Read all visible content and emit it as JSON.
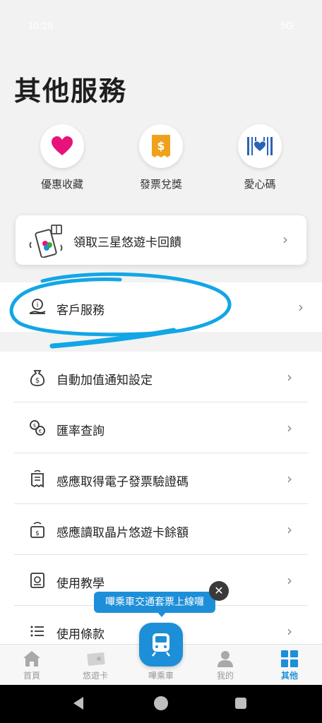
{
  "status_bar": {
    "time": "10:28",
    "network": "5G"
  },
  "page_title": "其他服務",
  "quick_actions": [
    {
      "label": "優惠收藏",
      "icon": "heart-icon"
    },
    {
      "label": "發票兌獎",
      "icon": "receipt-icon"
    },
    {
      "label": "愛心碼",
      "icon": "love-barcode-icon"
    }
  ],
  "promo": {
    "label": "領取三星悠遊卡回饋",
    "icon": "phone-gift-icon"
  },
  "customer_service": {
    "label": "客戶服務",
    "icon": "support-agent-icon"
  },
  "menu": [
    {
      "label": "自動加值通知設定",
      "icon": "money-bag-icon"
    },
    {
      "label": "匯率查詢",
      "icon": "exchange-icon"
    },
    {
      "label": "感應取得電子發票驗證碼",
      "icon": "invoice-icon"
    },
    {
      "label": "感應讀取晶片悠遊卡餘額",
      "icon": "card-balance-icon"
    },
    {
      "label": "使用教學",
      "icon": "tutorial-icon"
    },
    {
      "label": "使用條款",
      "icon": "list-icon"
    }
  ],
  "tooltip": {
    "text": "嗶乘車交通套票上線囉"
  },
  "bottom_nav": [
    {
      "label": "首頁",
      "icon": "home-icon"
    },
    {
      "label": "悠遊卡",
      "icon": "card-icon"
    },
    {
      "label": "嗶乘車",
      "icon": "train-icon"
    },
    {
      "label": "我的",
      "icon": "person-icon"
    },
    {
      "label": "其他",
      "icon": "grid-icon",
      "active": true
    }
  ],
  "colors": {
    "accent": "#1d8fd8",
    "heart": "#e8137a",
    "receipt": "#f0a11b",
    "love_code": "#2a63b6"
  }
}
